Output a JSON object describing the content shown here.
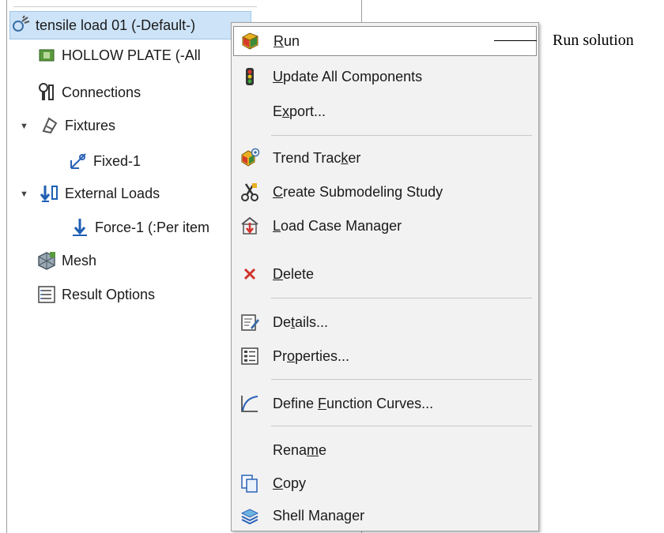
{
  "tree": {
    "items": [
      {
        "label": "tensile load 01 (-Default-)",
        "icon": "study-icon",
        "selected": true
      },
      {
        "label": "HOLLOW PLATE (-All",
        "icon": "part-icon"
      },
      {
        "label": "Connections",
        "icon": "connections-icon"
      },
      {
        "label": "Fixtures",
        "icon": "fixtures-icon",
        "expander": "▼"
      },
      {
        "label": "Fixed-1",
        "icon": "fixed-icon"
      },
      {
        "label": "External Loads",
        "icon": "external-loads-icon",
        "expander": "▼"
      },
      {
        "label": "Force-1 (:Per item",
        "icon": "force-icon"
      },
      {
        "label": "Mesh",
        "icon": "mesh-icon"
      },
      {
        "label": "Result Options",
        "icon": "result-options-icon"
      }
    ]
  },
  "menu": {
    "items": [
      {
        "pre": "",
        "mn": "R",
        "post": "un",
        "icon": "run-icon"
      },
      {
        "pre": "",
        "mn": "U",
        "post": "pdate All Components",
        "icon": "traffic-light-icon"
      },
      {
        "pre": "E",
        "mn": "x",
        "post": "port...",
        "icon": ""
      },
      {
        "pre": "Trend Trac",
        "mn": "k",
        "post": "er",
        "icon": "trend-tracker-icon"
      },
      {
        "pre": "",
        "mn": "C",
        "post": "reate Submodeling Study",
        "icon": "scissors-icon"
      },
      {
        "pre": "",
        "mn": "L",
        "post": "oad Case Manager",
        "icon": "load-case-icon"
      },
      {
        "pre": "",
        "mn": "D",
        "post": "elete",
        "icon": "delete-icon"
      },
      {
        "pre": "De",
        "mn": "t",
        "post": "ails...",
        "icon": "details-icon"
      },
      {
        "pre": "Pr",
        "mn": "o",
        "post": "perties...",
        "icon": "properties-icon"
      },
      {
        "pre": "Define ",
        "mn": "F",
        "post": "unction Curves...",
        "icon": "function-curve-icon"
      },
      {
        "pre": "Rena",
        "mn": "m",
        "post": "e",
        "icon": ""
      },
      {
        "pre": "",
        "mn": "C",
        "post": "opy",
        "icon": "copy-icon"
      },
      {
        "pre": "Shell Manager",
        "mn": "",
        "post": "",
        "icon": "shell-manager-icon"
      }
    ]
  },
  "callout": {
    "text": "Run solution"
  },
  "colors": {
    "selection": "#cde3f7",
    "menu_bg": "#f2f2f2",
    "delete_red": "#d0332c"
  }
}
